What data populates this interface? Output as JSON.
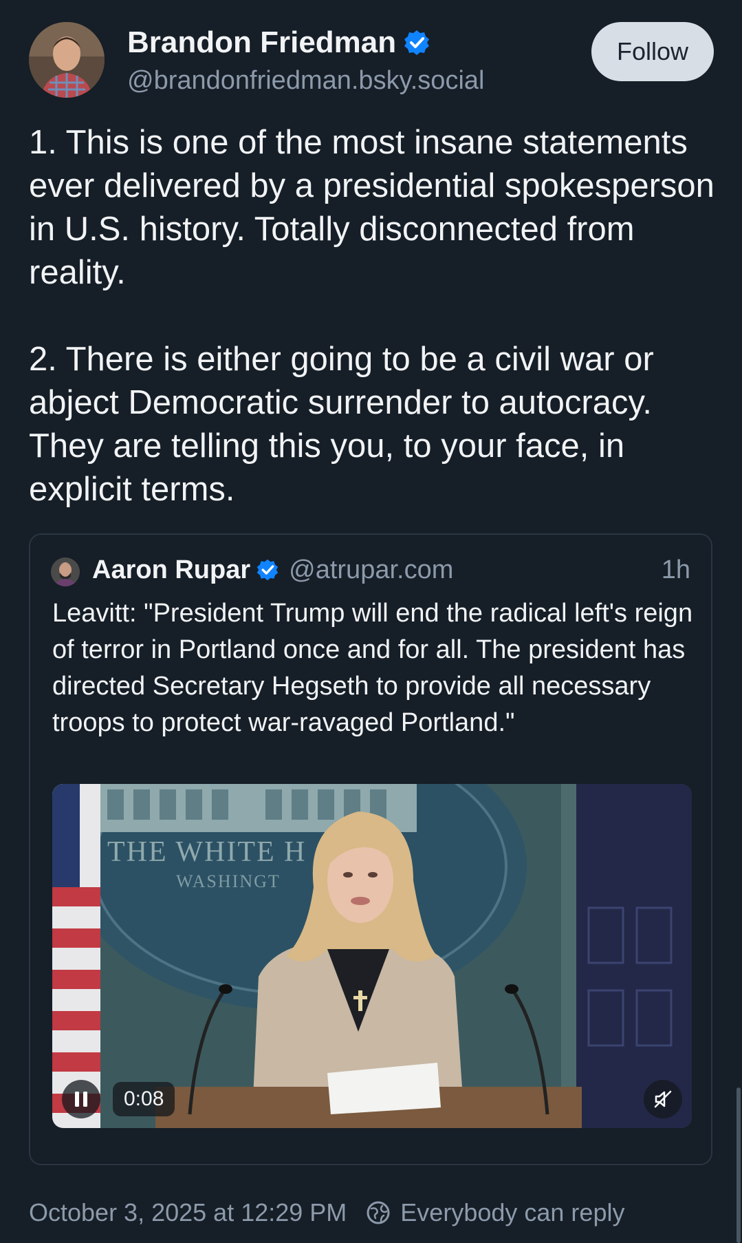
{
  "author": {
    "display_name": "Brandon Friedman",
    "handle": "@brandonfriedman.bsky.social",
    "verified_icon": "verified-check-icon"
  },
  "follow_label": "Follow",
  "post": {
    "paragraph1": "1. This is one of the most insane statements ever delivered by a presidential spokesperson in U.S. history. Totally disconnected from reality.",
    "paragraph2": "2. There is either going to be a civil war or abject Democratic surrender to autocracy. They are telling this you, to your face, in explicit terms."
  },
  "quote": {
    "display_name": "Aaron Rupar",
    "handle": "@atrupar.com",
    "time": "1h",
    "text": "Leavitt: \"President Trump will end the radical left's reign of terror in Portland once and for all. The president has directed Secretary Hegseth to provide all necessary troops to protect war-ravaged Portland.\"",
    "video": {
      "elapsed": "0:08",
      "backdrop_text1": "THE WHITE H",
      "backdrop_text2": "WASHINGT"
    }
  },
  "footer": {
    "timestamp": "October 3, 2025 at 12:29 PM",
    "reply_setting": "Everybody can reply"
  },
  "colors": {
    "background": "#161e27",
    "accent": "#1083fe",
    "muted": "#8c9aab"
  }
}
